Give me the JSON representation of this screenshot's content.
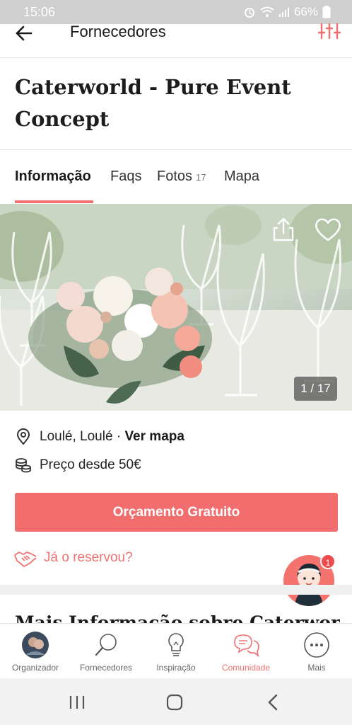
{
  "status_bar": {
    "time": "15:06",
    "battery": "66%"
  },
  "header": {
    "title": "Fornecedores",
    "back_icon": "arrow-left-icon",
    "filter_icon": "sliders-icon"
  },
  "vendor": {
    "name": "Caterworld - Pure Event Concept"
  },
  "tabs": [
    {
      "label": "Informação",
      "active": true
    },
    {
      "label": "Faqs"
    },
    {
      "label": "Fotos",
      "count": "17"
    },
    {
      "label": "Mapa"
    }
  ],
  "gallery": {
    "counter": "1 / 17",
    "share_icon": "share-icon",
    "favorite_icon": "heart-icon"
  },
  "location": {
    "text": "Loulé, Loulé",
    "separator": " · ",
    "map_link": "Ver mapa"
  },
  "price": {
    "text": "Preço desde 50€"
  },
  "cta": {
    "label": "Orçamento Gratuito"
  },
  "reserved": {
    "label": "Já o reservou?"
  },
  "chat": {
    "badge": "1"
  },
  "section": {
    "title": "Mais Informação sobre Caterworld"
  },
  "bottom_nav": [
    {
      "label": "Organizador",
      "icon": "avatar-icon"
    },
    {
      "label": "Fornecedores",
      "icon": "search-icon"
    },
    {
      "label": "Inspiração",
      "icon": "lightbulb-icon"
    },
    {
      "label": "Comunidade",
      "icon": "chat-bubbles-icon",
      "active": true
    },
    {
      "label": "Mais",
      "icon": "more-icon"
    }
  ],
  "colors": {
    "accent": "#f26d6d",
    "status_bar": "#cfcfcf"
  }
}
